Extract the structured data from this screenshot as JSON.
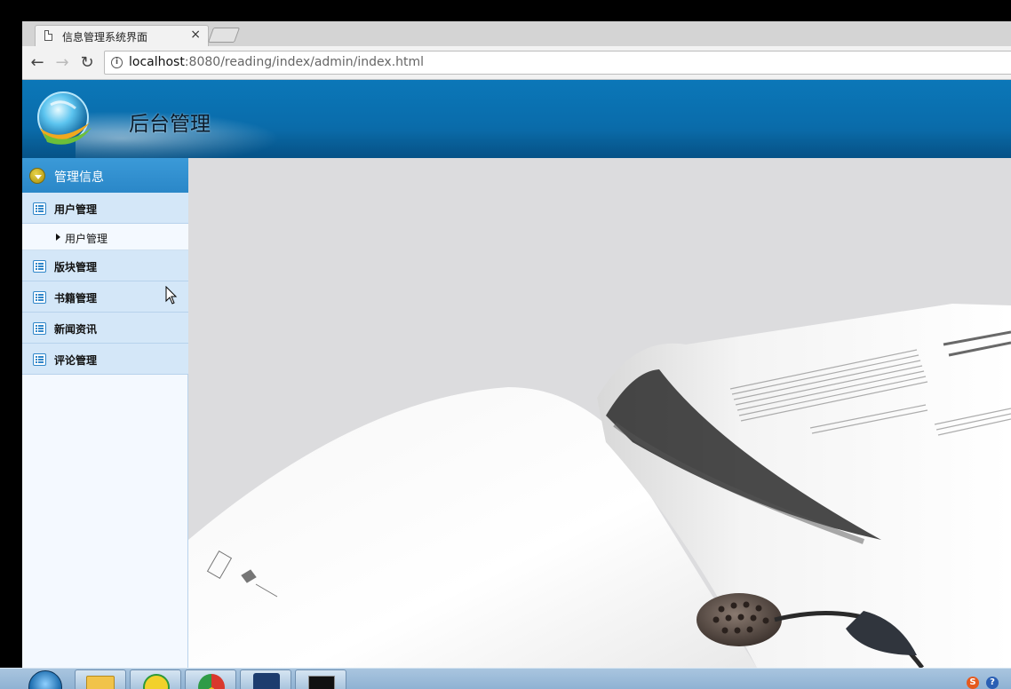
{
  "browser": {
    "tab_title": "信息管理系统界面",
    "tab_close": "×",
    "url_host": "localhost",
    "url_rest": ":8080/reading/index/admin/index.html",
    "back_glyph": "←",
    "forward_glyph": "→",
    "reload_glyph": "↻",
    "info_glyph": "i"
  },
  "header": {
    "title": "后台管理"
  },
  "sidebar": {
    "section_label": "管理信息",
    "items": [
      {
        "label": "用户管理",
        "icon": "list-icon",
        "sub_items": [
          {
            "label": "用户管理"
          }
        ]
      },
      {
        "label": "版块管理",
        "icon": "list-icon"
      },
      {
        "label": "书籍管理",
        "icon": "list-icon"
      },
      {
        "label": "新闻资讯",
        "icon": "list-icon"
      },
      {
        "label": "评论管理",
        "icon": "list-icon"
      }
    ]
  },
  "taskbar": {
    "tray_s": "S",
    "tray_q": "?"
  },
  "colors": {
    "header_blue": "#0b77b8",
    "sidebar_header": "#3b9ad8",
    "nav_item_bg": "#d4e7f8",
    "sidebar_bg": "#f4f9ff",
    "main_bg": "#dcdcde"
  }
}
